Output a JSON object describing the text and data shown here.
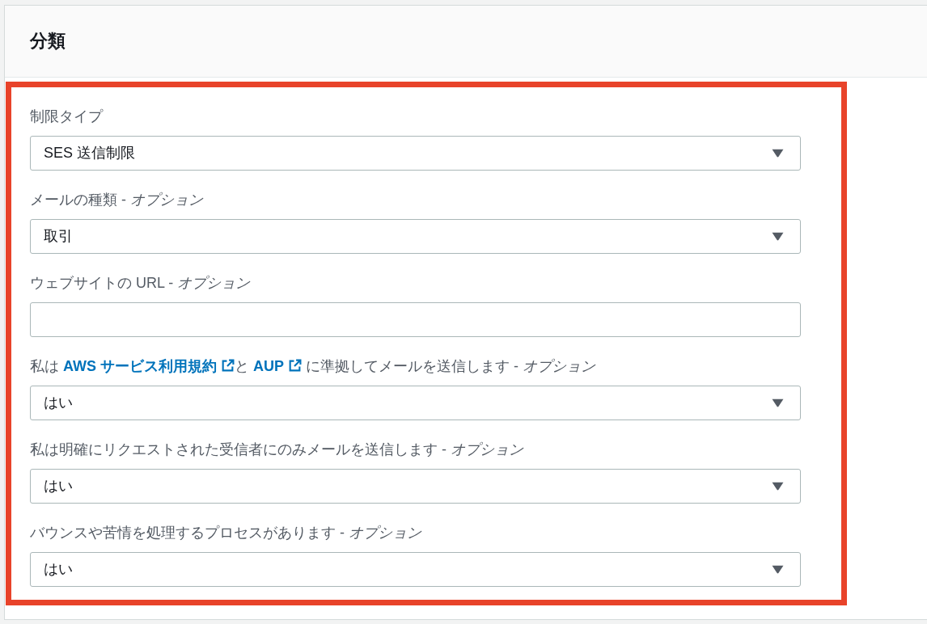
{
  "panel": {
    "title": "分類"
  },
  "fields": [
    {
      "kind": "select",
      "label_parts": [
        {
          "kind": "text",
          "text": "制限タイプ"
        }
      ],
      "value": "SES 送信制限"
    },
    {
      "kind": "select",
      "label_parts": [
        {
          "kind": "text",
          "text": "メールの種類 - *オプション*"
        }
      ],
      "value": "取引"
    },
    {
      "kind": "input",
      "label_parts": [
        {
          "kind": "text",
          "text": "ウェブサイトの URL - *オプション*"
        }
      ]
    },
    {
      "kind": "select",
      "label_parts": [
        {
          "kind": "text",
          "text": "私は "
        },
        {
          "kind": "link",
          "text": "AWS サービス利用規約"
        },
        {
          "kind": "text",
          "text": "と "
        },
        {
          "kind": "link",
          "text": "AUP"
        },
        {
          "kind": "text",
          "text": " に準拠してメールを送信します - *オプション*"
        }
      ],
      "value": "はい"
    },
    {
      "kind": "select",
      "label_parts": [
        {
          "kind": "text",
          "text": "私は明確にリクエストされた受信者にのみメールを送信します - *オプション*"
        }
      ],
      "value": "はい"
    },
    {
      "kind": "select",
      "label_parts": [
        {
          "kind": "text",
          "text": "バウンスや苦情を処理するプロセスがあります - *オプション*"
        }
      ],
      "value": "はい"
    }
  ]
}
